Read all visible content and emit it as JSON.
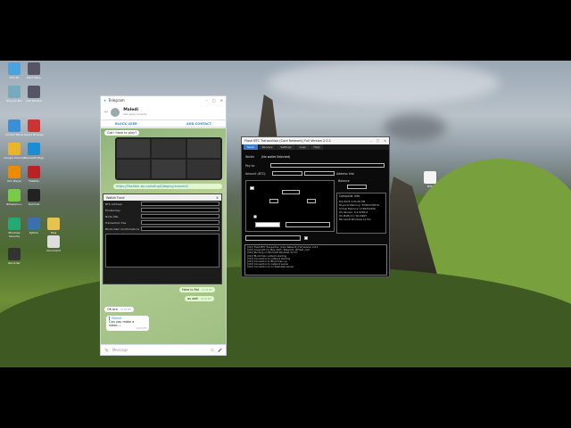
{
  "desktop": {
    "icons": [
      {
        "label": "This PC",
        "color": "#4aa3df"
      },
      {
        "label": "Start Menu",
        "color": "#556"
      },
      {
        "label": "Recycle Bin",
        "color": "#7ab"
      },
      {
        "label": "Get Started",
        "color": "#556"
      },
      {
        "label": "Control Panel",
        "color": "#3b8fd6"
      },
      {
        "label": "Opera Browser",
        "color": "#c33"
      },
      {
        "label": "Google Chrome",
        "color": "#e9b52a"
      },
      {
        "label": "Microsoft Edge",
        "color": "#1a8dd6"
      },
      {
        "label": "VLC Player",
        "color": "#f08a00"
      },
      {
        "label": "FileZilla",
        "color": "#b22"
      },
      {
        "label": "Notepad++",
        "color": "#7c4"
      },
      {
        "label": "Terminal",
        "color": "#222"
      },
      {
        "label": "Windows Security",
        "color": "#2a7"
      },
      {
        "label": "Python",
        "color": "#3a6fb0"
      },
      {
        "label": "Files",
        "color": "#e8c24a"
      },
      {
        "label": "Document",
        "color": "#ddd"
      },
      {
        "label": "Recorder",
        "color": "#333"
      }
    ],
    "right_icon": {
      "label": "BTC"
    }
  },
  "telegram": {
    "app": "Telegram",
    "contact_name": "Maledi",
    "contact_status": "last seen recently",
    "block_label": "BLOCK USER",
    "add_label": "ADD CONTACT",
    "msg_play": "Got I have to play?",
    "link": "https://flashbtc.zip.co/rollup/Qdeploy/connect/",
    "msg_test": "Here is flat",
    "msg_test_time": "10:03 PM",
    "msg_aswell": "as well",
    "msg_aswell_time": "10:04 PM",
    "msg_ok": "OK bro",
    "msg_ok_time": "10:04 PM",
    "reply_name": "Maledi",
    "reply_text": "Can you make a video....",
    "reply_time": "10:05 PM",
    "composer": "Message"
  },
  "wallet": {
    "title": "Wallet Fund",
    "rows": [
      {
        "label": "BTC Address",
        "value": ""
      },
      {
        "label": "Private Key",
        "value": ""
      },
      {
        "label": "Node URL",
        "value": ""
      },
      {
        "label": "Transaction Fee",
        "value": ""
      },
      {
        "label": "Blockchain Confirmations",
        "value": ""
      }
    ]
  },
  "btc": {
    "title": "Flash BTC Transaction (Core Network) Full Version 2.0.1",
    "tabs": [
      "Send",
      "Receive",
      "Settings",
      "Logs",
      "Help"
    ],
    "active_tab": 0,
    "wallet_label": "Wallet",
    "wallet_value": "(No wallet Selected)",
    "pay_to_label": "Pay to:",
    "amount_label": "Amount (BTC):",
    "address_info": "Address Info",
    "balance": "Balance",
    "computer_info": "Computer Info",
    "info_lines": [
      "8/1/2025 2:05:30 PM",
      "Physical Memory: 34345232576",
      "Virtual Memory: 1795252256",
      "OS Version: 6.2.9200.0",
      "OS Platform: Win32NT",
      "Microsoft Windows 11 Pro"
    ],
    "log_lines": [
      "[Info] Flash BTC Transaction (Core Network) Full Version 2.0.1",
      "[Info] Copyright (C) May 2025, Telegram: @Flash_com",
      "[Info] Running on Microsoft Windows 11 Pro",
      "[Info] Blockchain network starting",
      "[Info] Connection to network starting",
      "[Info] Connection to Blockchain up",
      "[Info] Connection to network server",
      "[Info] Connection to orchestrated server"
    ]
  }
}
